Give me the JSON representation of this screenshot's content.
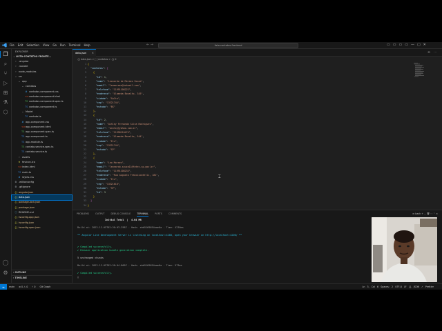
{
  "titlebar": {
    "menu": [
      "File",
      "Edit",
      "Selection",
      "View",
      "Go",
      "Run",
      "Terminal",
      "Help"
    ],
    "nav_arrows": "← →",
    "search": "lista-contatos-frontend",
    "window_controls": [
      "—",
      "▢",
      "✕"
    ]
  },
  "activity_bar": {
    "icons": [
      "files-icon",
      "search-icon",
      "source-control-icon",
      "run-debug-icon",
      "extensions-icon",
      "testing-icon",
      "remote-icon",
      "accounts-icon",
      "settings-icon"
    ]
  },
  "explorer": {
    "header": "EXPLORER",
    "project": "LISTA-CONTATOS-FRONTE...",
    "tree": [
      {
        "depth": 0,
        "kind": "folder",
        "label": ".angular"
      },
      {
        "depth": 0,
        "kind": "folder",
        "label": ".vscode"
      },
      {
        "depth": 0,
        "kind": "folder",
        "label": "node_modules"
      },
      {
        "depth": 0,
        "kind": "folder-open",
        "label": "src"
      },
      {
        "depth": 1,
        "kind": "folder-open",
        "label": "app"
      },
      {
        "depth": 2,
        "kind": "folder-open",
        "label": "contatos"
      },
      {
        "depth": 3,
        "kind": "css",
        "label": "contatos.component.css"
      },
      {
        "depth": 3,
        "kind": "html",
        "label": "contatos.component.html"
      },
      {
        "depth": 3,
        "kind": "spec",
        "label": "contatos.component.spec.ts"
      },
      {
        "depth": 3,
        "kind": "ts",
        "label": "contatos.component.ts"
      },
      {
        "depth": 2,
        "kind": "folder-open",
        "label": "Model"
      },
      {
        "depth": 3,
        "kind": "ts",
        "label": "contato.ts"
      },
      {
        "depth": 2,
        "kind": "css",
        "label": "app.component.css"
      },
      {
        "depth": 2,
        "kind": "html",
        "label": "app.component.html"
      },
      {
        "depth": 2,
        "kind": "spec",
        "label": "app.component.spec.ts"
      },
      {
        "depth": 2,
        "kind": "ts",
        "label": "app.component.ts"
      },
      {
        "depth": 2,
        "kind": "ts",
        "label": "app.module.ts"
      },
      {
        "depth": 2,
        "kind": "spec",
        "label": "contato.service.spec.ts"
      },
      {
        "depth": 2,
        "kind": "ts",
        "label": "contato.service.ts"
      },
      {
        "depth": 1,
        "kind": "folder",
        "label": "assets"
      },
      {
        "depth": 1,
        "kind": "ico",
        "label": "favicon.ico"
      },
      {
        "depth": 1,
        "kind": "html",
        "label": "index.html"
      },
      {
        "depth": 1,
        "kind": "ts",
        "label": "main.ts"
      },
      {
        "depth": 1,
        "kind": "css",
        "label": "styles.css"
      },
      {
        "depth": 0,
        "kind": "config",
        "label": ".editorconfig"
      },
      {
        "depth": 0,
        "kind": "config",
        "label": ".gitignore"
      },
      {
        "depth": 0,
        "kind": "json",
        "label": "angular.json"
      },
      {
        "depth": 0,
        "kind": "json",
        "label": "data.json",
        "selected": true
      },
      {
        "depth": 0,
        "kind": "json",
        "label": "package-lock.json"
      },
      {
        "depth": 0,
        "kind": "json",
        "label": "package.json"
      },
      {
        "depth": 0,
        "kind": "md",
        "label": "README.md"
      },
      {
        "depth": 0,
        "kind": "json",
        "label": "tsconfig.app.json"
      },
      {
        "depth": 0,
        "kind": "json",
        "label": "tsconfig.json"
      },
      {
        "depth": 0,
        "kind": "json",
        "label": "tsconfig.spec.json"
      }
    ],
    "outline": "OUTLINE",
    "timeline": "TIMELINE"
  },
  "editor": {
    "tab_label": "data.json",
    "breadcrumb": "{} data.json > [ ] contatos > {} 0",
    "lines": [
      {
        "n": "1",
        "t": "{"
      },
      {
        "n": "2",
        "t": "  \"contatos\": ["
      },
      {
        "n": "3",
        "t": "    {"
      },
      {
        "n": "4",
        "t": "      \"id\": 1,"
      },
      {
        "n": "5",
        "t": "      \"nome\": \"Leonardo de Moraes Souza\","
      },
      {
        "n": "6",
        "t": "      \"email\": \"leomoraes@hotmail.com\","
      },
      {
        "n": "7",
        "t": "      \"telefone\": \"11991108222\","
      },
      {
        "n": "8",
        "t": "      \"endereco\": \"Alameda Bonalto, 345\","
      },
      {
        "n": "9",
        "t": "      \"cidade\": \"Salto\","
      },
      {
        "n": "10",
        "t": "      \"cep\": \"13321744\","
      },
      {
        "n": "11",
        "t": "      \"estado\": \"BS\""
      },
      {
        "n": "12",
        "t": "    },"
      },
      {
        "n": "13",
        "t": "    {"
      },
      {
        "n": "14",
        "t": "      \"id\": 2,"
      },
      {
        "n": "15",
        "t": "      \"nome\": \"Ashley Fernanda Silva Rodrigues\","
      },
      {
        "n": "16",
        "t": "      \"email\": \"ashley@yahoo.com.br\","
      },
      {
        "n": "17",
        "t": "      \"telefone\": \"11998110474\","
      },
      {
        "n": "18",
        "t": "      \"endereco\": \"Alameda Bonalto, 544\","
      },
      {
        "n": "19",
        "t": "      \"cidade\": \"Itu\","
      },
      {
        "n": "20",
        "t": "      \"cep\": \"13321744\","
      },
      {
        "n": "21",
        "t": "      \"estado\": \"SP\""
      },
      {
        "n": "22",
        "t": "    },"
      },
      {
        "n": "23",
        "t": "    {"
      },
      {
        "n": "24",
        "t": "      \"nome\": \"Leo Moraes\","
      },
      {
        "n": "25",
        "t": "      \"email\": \"leonardo.souza11@fatec.sp.gov.br\","
      },
      {
        "n": "26",
        "t": "      \"telefone\": \"11991108233\","
      },
      {
        "n": "27",
        "t": "      \"endereco\": \"Rua Augusto Franciscatelli, 181\","
      },
      {
        "n": "28",
        "t": "      \"cidade\": \"Itu\","
      },
      {
        "n": "29",
        "t": "      \"cep\": \"13321610\","
      },
      {
        "n": "30",
        "t": "      \"estado\": \"SP\","
      },
      {
        "n": "31",
        "t": "      \"id\": 3"
      },
      {
        "n": "32",
        "t": "    }"
      },
      {
        "n": "33",
        "t": "  ]"
      },
      {
        "n": "34",
        "t": "}"
      }
    ]
  },
  "panel": {
    "tabs": [
      "PROBLEMS",
      "OUTPUT",
      "DEBUG CONSOLE",
      "TERMINAL",
      "PORTS",
      "COMMENTS"
    ],
    "active_tab": "TERMINAL",
    "terminal_name": "bash",
    "terminal_lines": [
      "                   Initial Total  |  4.04 MB",
      "",
      "Build at: 2023-12-05T02:20:03.398Z - Hash: ebb5169054aae6a - Time: 4236ms",
      "",
      "** Angular Live Development Server is listening on localhost:4200, open your browser on http://localhost:4200/ **",
      "",
      "",
      "✔ Compiled successfully.",
      "✔ Browser application bundle generation complete.",
      "",
      "5 unchanged chunks",
      "",
      "Build at: 2023-12-05T02:20:04.860Z - Hash: ebb5169054aae6a - Time: 573ms",
      "",
      "✔ Compiled successfully.",
      "▯"
    ]
  },
  "statusbar": {
    "left": [
      "main",
      "⊗ 0  ⚠ 0",
      "⑂ 0",
      "Git Graph"
    ],
    "right": "Ln 3, Col 6   Spaces: 2   UTF-8   LF   {} JSON   ✓ Prettier"
  },
  "colors": {
    "accent": "#0078d4",
    "bg": "#1f1f1f",
    "sidebar_bg": "#181818",
    "json_key": "#9cdcfe",
    "json_string": "#ce9178",
    "json_number": "#b5cea8"
  }
}
